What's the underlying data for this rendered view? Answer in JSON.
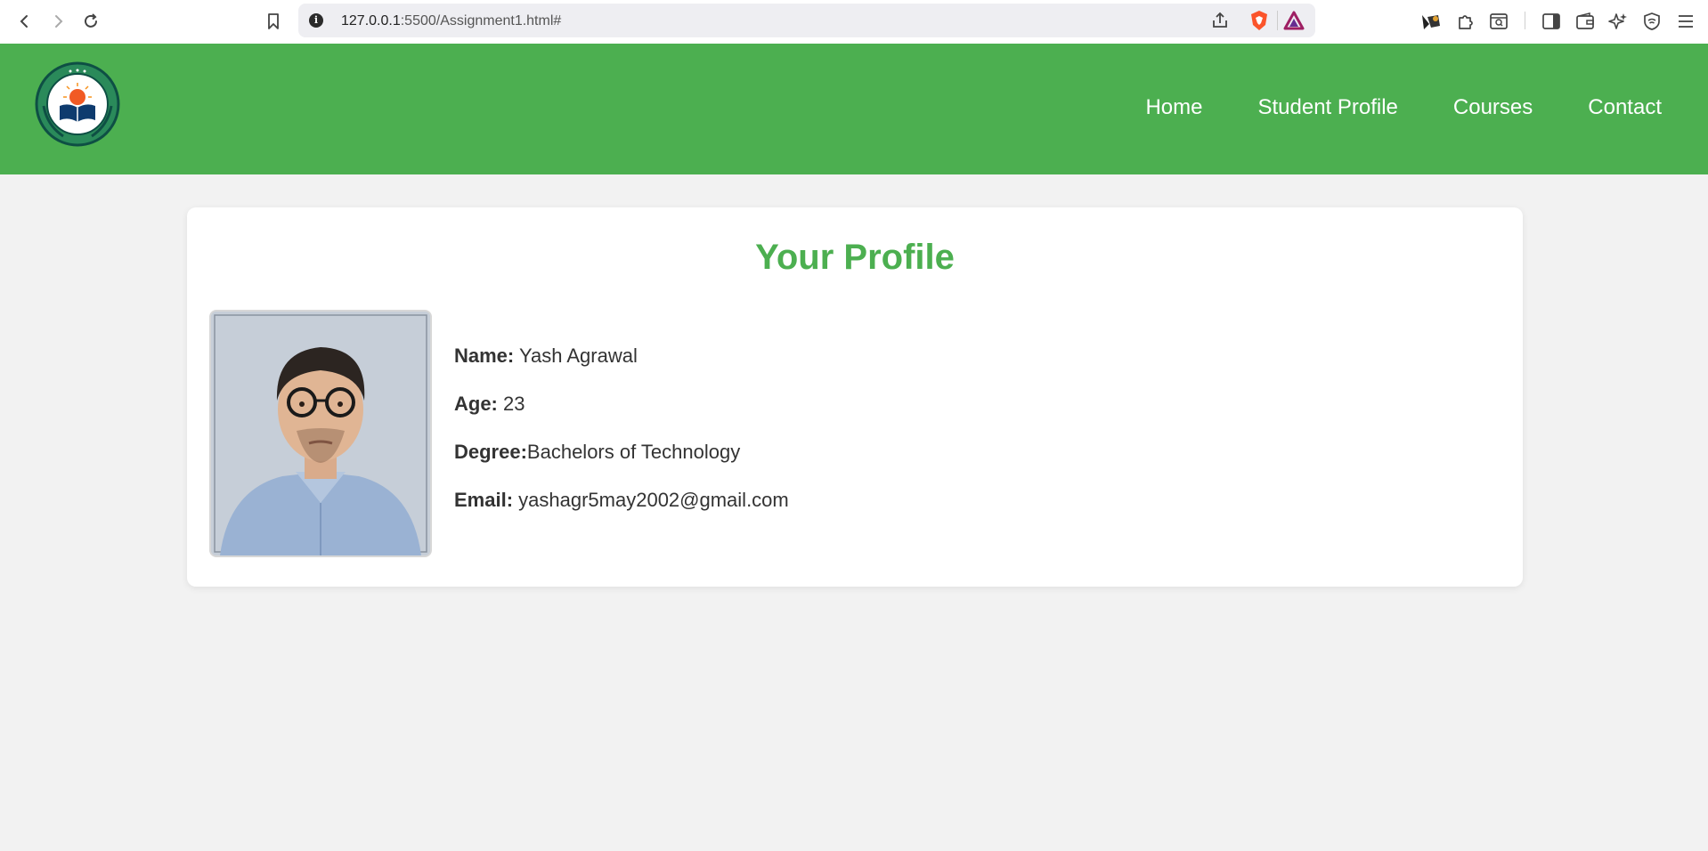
{
  "browser": {
    "url_host": "127.0.0.1",
    "url_path": ":5500/Assignment1.html#",
    "icons": [
      "back-icon",
      "forward-icon",
      "reload-icon",
      "bookmark-icon",
      "site-info-icon",
      "share-icon",
      "brave-shield-icon",
      "brave-rewards-icon",
      "extension-icon",
      "puzzle-icon",
      "search-tab-icon",
      "sidebar-icon",
      "wallet-icon",
      "leo-ai-icon",
      "vpn-icon",
      "menu-icon"
    ]
  },
  "site": {
    "nav": [
      "Home",
      "Student Profile",
      "Courses",
      "Contact"
    ],
    "accent_color": "#4caf50"
  },
  "profile": {
    "heading": "Your Profile",
    "name_label": "Name:",
    "name_value": "Yash Agrawal",
    "age_label": "Age:",
    "age_value": "23",
    "degree_label": "Degree:",
    "degree_value": "Bachelors of Technology",
    "email_label": "Email:",
    "email_value": "yashagr5may2002@gmail.com"
  }
}
